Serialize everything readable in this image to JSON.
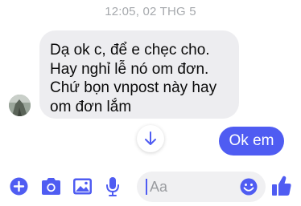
{
  "conversation": {
    "timestamp": "12:05, 02 THG 5",
    "incoming_message": {
      "lines": [
        "Dạ ok c, để e chẹc cho.",
        "Hay nghỉ lễ nó om đơn.",
        "Chứ bọn vnpost này hay",
        "om đơn lắm"
      ],
      "bubble_color": "#ededf0"
    },
    "outgoing_message": {
      "text": "Ok em",
      "bubble_color": "#4f5cf2"
    },
    "scroll_down_icon": "arrow-down-icon"
  },
  "composer": {
    "placeholder": "Aa",
    "accent_color": "#4f5cf2",
    "icons": [
      "plus-circle-icon",
      "camera-icon",
      "image-icon",
      "microphone-icon",
      "emoji-icon",
      "thumbs-up-icon"
    ]
  }
}
